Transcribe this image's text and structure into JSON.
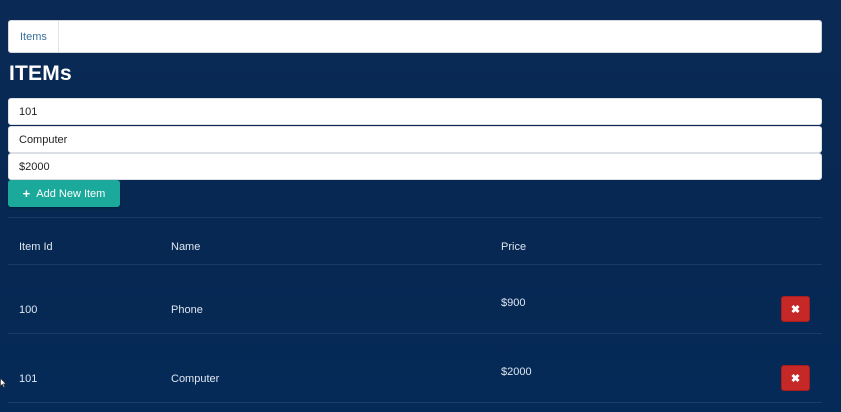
{
  "breadcrumb": {
    "items": [
      "Items"
    ]
  },
  "page": {
    "title": "ITEMs"
  },
  "form": {
    "item_id_value": "101",
    "name_value": "Computer",
    "price_value": "$2000",
    "add_button_label": "Add New Item"
  },
  "table": {
    "headers": [
      "Item Id",
      "Name",
      "Price"
    ],
    "rows": [
      {
        "id": "100",
        "name": "Phone",
        "price": "$900"
      },
      {
        "id": "101",
        "name": "Computer",
        "price": "$2000"
      }
    ]
  },
  "icons": {
    "add": "plus-icon",
    "delete": "close-icon"
  },
  "colors": {
    "add_button": "#1aa99a",
    "delete_button": "#c62828",
    "background": "#062852"
  }
}
